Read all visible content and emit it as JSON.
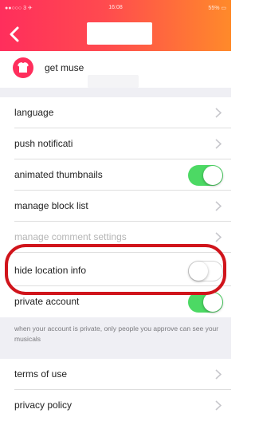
{
  "status_bar": {
    "carrier": "●●○○○ 3 ✈",
    "time": "16:08",
    "battery": "55% ▭"
  },
  "header": {
    "back_icon": "chevron-left-icon",
    "title": ""
  },
  "profile": {
    "icon": "tshirt-icon",
    "name": "get muse"
  },
  "settings": {
    "language": "language",
    "push_notifications": "push notificati",
    "animated_thumbnails": "animated thumbnails",
    "manage_block_list": "manage block list",
    "hidden_row": "manage comment settings",
    "hide_location_info": "hide location info",
    "private_account": "private account",
    "private_note": "when your account is private, only people you approve can see your musicals",
    "terms_of_use": "terms of use",
    "privacy_policy": "privacy policy"
  },
  "toggles": {
    "animated_thumbnails": true,
    "hide_location_info": false,
    "private_account": true
  },
  "colors": {
    "header_gradient_start": "#ff2e5c",
    "header_gradient_end": "#ff8a2a",
    "toggle_on": "#4cd964",
    "highlight_outline": "#d0141b"
  }
}
